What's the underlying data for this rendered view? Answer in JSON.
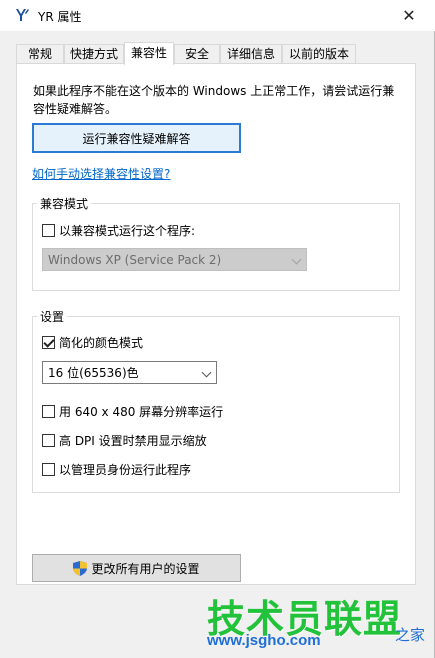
{
  "window": {
    "title": "YR 属性",
    "close_glyph": "✕"
  },
  "tabs": [
    {
      "label": "常规",
      "active": false
    },
    {
      "label": "快捷方式",
      "active": false
    },
    {
      "label": "兼容性",
      "active": true
    },
    {
      "label": "安全",
      "active": false
    },
    {
      "label": "详细信息",
      "active": false
    },
    {
      "label": "以前的版本",
      "active": false
    }
  ],
  "compat": {
    "intro": "如果此程序不能在这个版本的 Windows 上正常工作，请尝试运行兼容性疑难解答。",
    "troubleshooter_button": "运行兼容性疑难解答",
    "manual_link": "如何手动选择兼容性设置?"
  },
  "compat_mode": {
    "group_label": "兼容模式",
    "checkbox_label": "以兼容模式运行这个程序:",
    "checked": false,
    "os_select_value": "Windows XP (Service Pack 2)",
    "os_select_disabled": true
  },
  "settings": {
    "group_label": "设置",
    "reduced_color_label": "简化的颜色模式",
    "reduced_color_checked": true,
    "color_select_value": "16 位(65536)色",
    "resolution_label": "用 640 x 480 屏幕分辨率运行",
    "resolution_checked": false,
    "dpi_label": "高 DPI 设置时禁用显示缩放",
    "dpi_checked": false,
    "admin_label": "以管理员身份运行此程序",
    "admin_checked": false
  },
  "all_users_button": "更改所有用户的设置",
  "watermark": {
    "title": "技术员联盟",
    "url": "www.jsgho.com",
    "suffix": "之家"
  },
  "colors": {
    "accent": "#0066cc",
    "focus_border": "#2d7ad2",
    "watermark_green": "#22c23a",
    "watermark_blue": "#1f6fd6"
  }
}
